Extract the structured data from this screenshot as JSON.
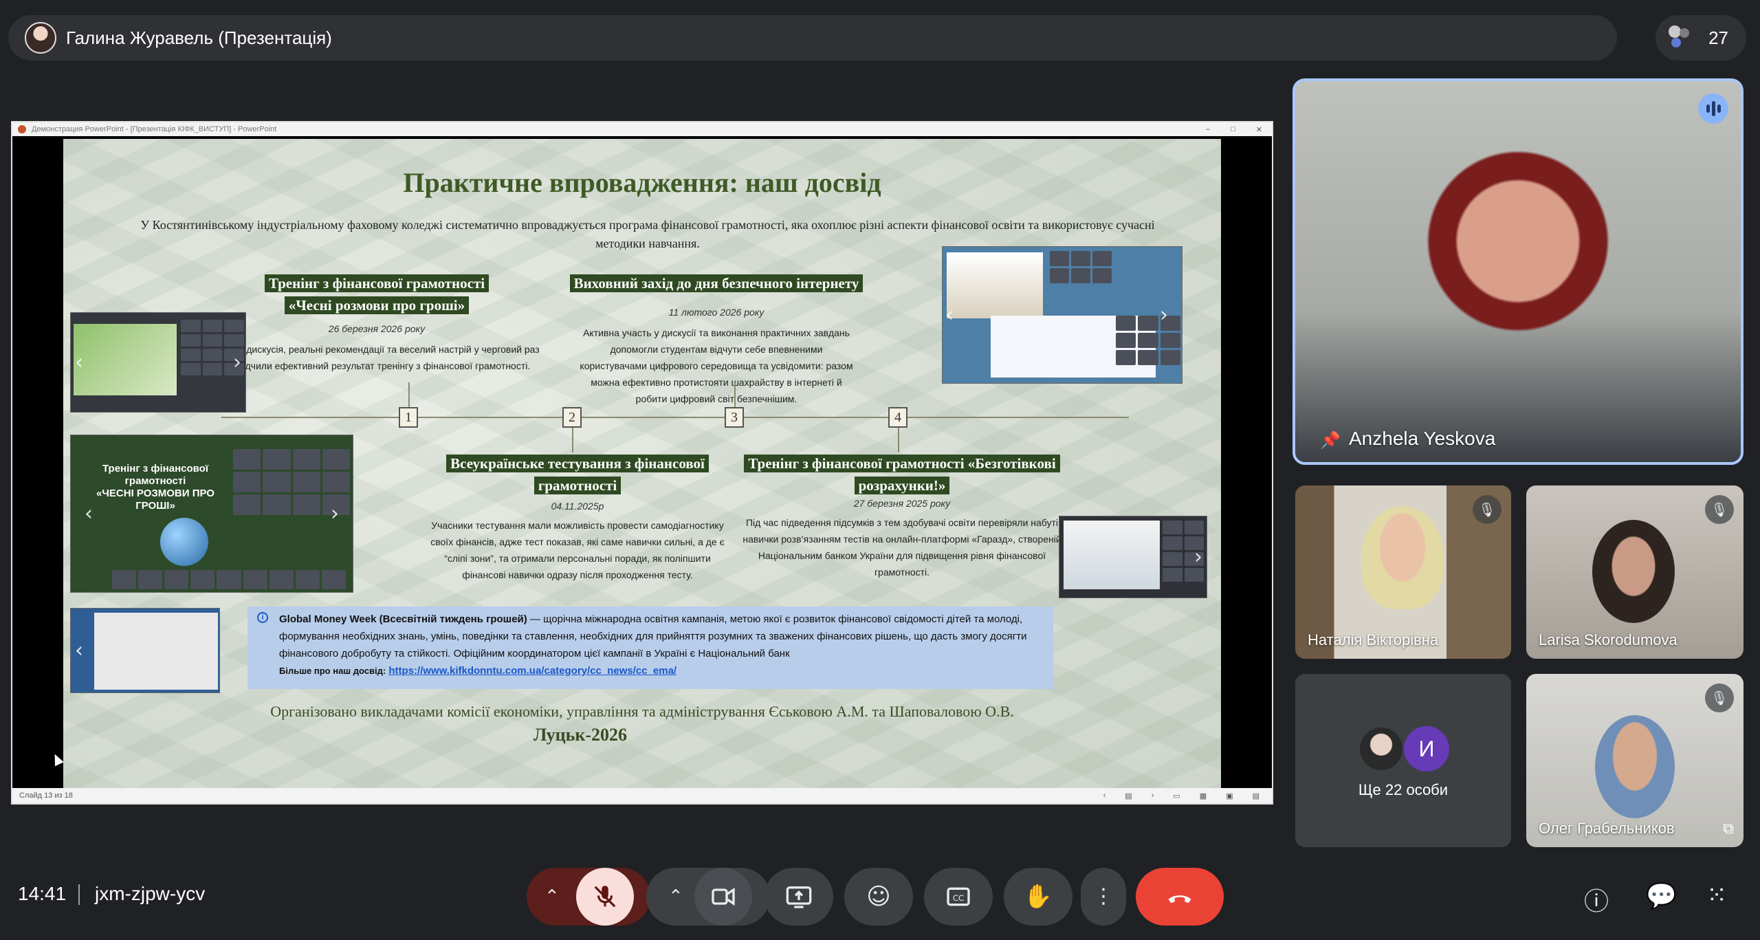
{
  "meeting": {
    "presenter_label": "Галина Журавель (Презентація)",
    "participant_count": "27",
    "time": "14:41",
    "meeting_code": "jxm-zjpw-ycv"
  },
  "ppt": {
    "window_title": "Демонстрация PowerPoint - [Презентація КІФК_ВИСТУП] - PowerPoint",
    "slide_counter": "Слайд 13 из 18"
  },
  "slide": {
    "title": "Практичне впровадження: наш досвід",
    "intro": "У Костянтинівському індустріальному фаховому коледжі систематично впроваджується програма фінансової грамотності, яка охоплює різні аспекти фінансової освіти та використовує сучасні методики навчання.",
    "s1_title_line1": "Тренінг з фінансової грамотності",
    "s1_title_line2": "«Чесні розмови про гроші»",
    "s1_date": "26 березня 2026 року",
    "s1_text": "Жвава дискусія, реальні рекомендації та веселий настрій у черговий раз засвідчили ефективний результат тренінгу з фінансової грамотності.",
    "s2_title": "Виховний захід до дня безпечного інтернету",
    "s2_date": "11 лютого 2026 року",
    "s2_text": "Активна участь у дискусії та виконання практичних завдань допомогли студентам відчути себе впевненими користувачами цифрового середовища та усвідомити: разом можна ефективно протистояти шахрайству в інтернеті й робити цифровий світ безпечнішим.",
    "s3_title_line1": "Всеукраїнське тестування з фінансової",
    "s3_title_line2": "грамотності",
    "s3_date": "04.11.2025р",
    "s3_text": "Учасники тестування мали можливість провести самодіагностику своїх фінансів, адже тест показав, які саме навички сильні, а де є “сліпі зони”, та отримали персональні поради, як поліпшити фінансові навички одразу після проходження тесту.",
    "s4_title_line1": "Тренінг з фінансової грамотності  «Безготівкові",
    "s4_title_line2": "розрахунки!»",
    "s4_date": "27 березня 2025 року",
    "s4_text": "Під час підведення підсумків з тем здобувачі освіти  перевіряли набуті навички  розв’язанням тестів на онлайн-платформі «Гаразд», створеній Національним банком України для підвищення рівня фінансової грамотності.",
    "timeline_numbers": [
      "1",
      "2",
      "3",
      "4"
    ],
    "thumb1_caption": "Тренінг з фінансової грамотності",
    "thumb1_caption2": "«ЧЕСНІ РОЗМОВИ ПРО ГРОШІ»",
    "info_bold": "Global Money Week (Всесвітній тиждень грошей)",
    "info_text": " — щорічна міжнародна освітня кампанія, метою якої є розвиток фінансової свідомості дітей та молоді, формування необхідних знань, умінь, поведінки та ставлення, необхідних для прийняття розумних та зважених фінансових рішень, що дасть змогу досягти фінансового добробуту та стійкості.  Офіційним координатором цієї кампанії в Україні є Національний банк",
    "info_more_label": "Більше про наш досвід:",
    "info_link": "https://www.kifkdonntu.com.ua/category/cc_news/cc_ema/",
    "footer": "Організовано викладачами комісії економіки, управління та адміністрування Єськовою А.М. та Шаповаловою О.В.",
    "city": "Луцьк-2026"
  },
  "participants": {
    "main_speaker": "Anzhela Yeskova",
    "tile1": "Наталія Вікторівна",
    "tile2": "Larisa Skorodumova",
    "others_label": "Ще 22 особи",
    "others_initial": "И",
    "tile4": "Олег Грабельников"
  },
  "colors": {
    "bg": "#202124",
    "pill": "#303134",
    "end_call": "#ea4335",
    "speaker_border": "#a8c7fa",
    "slide_heading": "#3e5a25"
  },
  "icons": {
    "controls": [
      "chevron-up-icon",
      "mic-off-icon",
      "camera-options-icon",
      "video-icon",
      "present-screen-icon",
      "emoji-icon",
      "captions-icon",
      "raise-hand-icon",
      "more-options-icon",
      "end-call-icon"
    ],
    "right": [
      "info-icon",
      "chat-icon",
      "activities-icon"
    ]
  }
}
